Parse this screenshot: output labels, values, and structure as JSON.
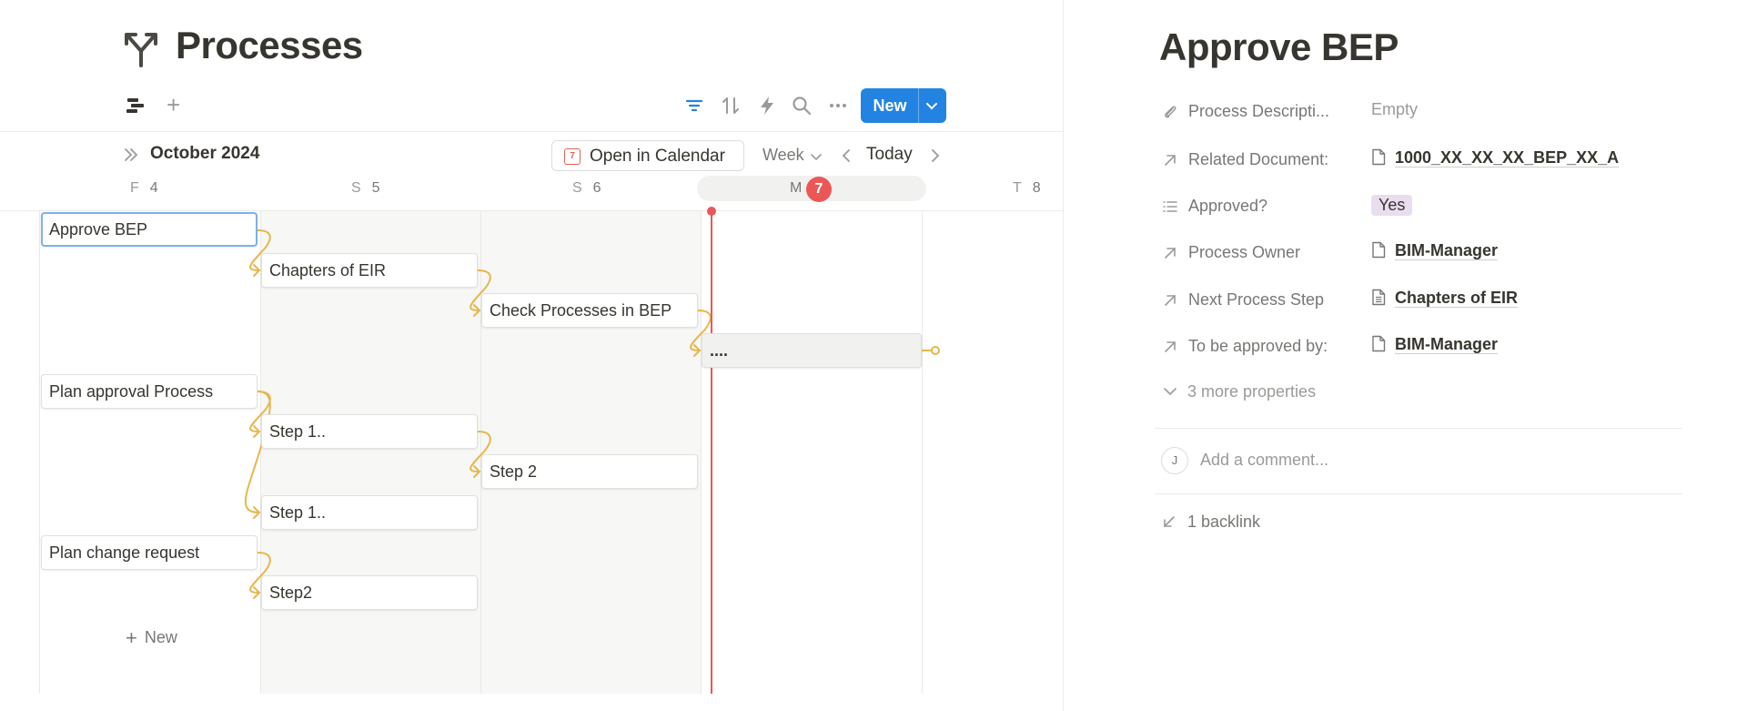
{
  "database": {
    "title": "Processes",
    "icon": "fork-arrows-icon"
  },
  "toolbar": {
    "new_label": "New",
    "icons": [
      "filter-icon",
      "sort-icon",
      "automation-bolt-icon",
      "search-icon",
      "more-icon"
    ],
    "accent_color": "#2383e2"
  },
  "calendar": {
    "month_label": "October 2024",
    "open_in_calendar_label": "Open in Calendar",
    "calendar_icon_day": "7",
    "range_label": "Week",
    "today_label": "Today",
    "days": [
      {
        "letter": "F",
        "num": "4"
      },
      {
        "letter": "S",
        "num": "5"
      },
      {
        "letter": "S",
        "num": "6"
      },
      {
        "letter": "M",
        "num": "7",
        "is_today": true
      },
      {
        "letter": "T",
        "num": "8"
      }
    ],
    "today_color": "#eb5757",
    "dependency_color": "#e8b64a",
    "new_row_label": "New"
  },
  "timeline_items": [
    {
      "name": "Approve BEP",
      "selected": true
    },
    {
      "name": "Chapters of EIR"
    },
    {
      "name": "Check Processes in BEP"
    },
    {
      "name": "...."
    },
    {
      "name": "Plan approval Process"
    },
    {
      "name": "Step 1.."
    },
    {
      "name": "Step 2"
    },
    {
      "name": "Step 1.."
    },
    {
      "name": "Plan change request"
    },
    {
      "name": "Step2"
    }
  ],
  "detail": {
    "title": "Approve BEP",
    "properties": [
      {
        "icon": "paperclip-icon",
        "name": "Process Descripti...",
        "value": "Empty",
        "kind": "empty"
      },
      {
        "icon": "relation-arrow-icon",
        "name": "Related Document:",
        "value": "1000_XX_XX_XX_BEP_XX_A",
        "kind": "page",
        "page_icon": "document-icon"
      },
      {
        "icon": "list-icon",
        "name": "Approved?",
        "value": "Yes",
        "kind": "tag",
        "tag_color": "#e8deee"
      },
      {
        "icon": "relation-arrow-icon",
        "name": "Process Owner",
        "value": "BIM-Manager",
        "kind": "page",
        "page_icon": "document-icon"
      },
      {
        "icon": "relation-arrow-icon",
        "name": "Next Process Step",
        "value": "Chapters of EIR",
        "kind": "page",
        "page_icon": "document-lines-icon"
      },
      {
        "icon": "relation-arrow-icon",
        "name": "To be approved by:",
        "value": "BIM-Manager",
        "kind": "page",
        "page_icon": "document-icon"
      }
    ],
    "more_properties_label": "3 more properties",
    "comment_avatar": "J",
    "comment_placeholder": "Add a comment...",
    "backlinks_label": "1 backlink"
  }
}
